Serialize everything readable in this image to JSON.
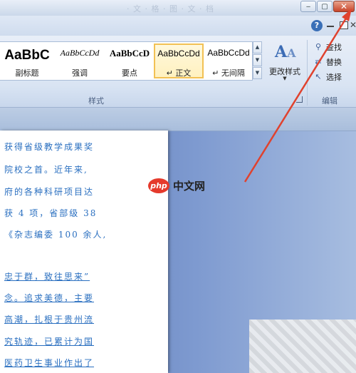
{
  "titlebar": {
    "faded_title": "· 文 · 格 · 图 · 文 · 档",
    "minimize": "‒",
    "maximize": "▢",
    "close": "✕"
  },
  "ribbon": {
    "help": "?",
    "close_doc": "✕"
  },
  "styles": {
    "group_label": "样式",
    "tiles": [
      {
        "preview": "AaBbC",
        "label": "副标题"
      },
      {
        "preview": "AaBbCcDd",
        "label": "强调"
      },
      {
        "preview": "AaBbCcD",
        "label": "要点"
      },
      {
        "preview": "AaBbCcDd",
        "label": "↵ 正文"
      },
      {
        "preview": "AaBbCcDd",
        "label": "↵ 无间隔"
      }
    ],
    "change_styles": "更改样式"
  },
  "editing": {
    "group_label": "编辑",
    "find": "查找",
    "replace": "替换",
    "select": "选择"
  },
  "document": {
    "lines": [
      "获得省级教学成果奖",
      "院校之首。近年来,",
      "府的各种科研项目达",
      "获 4 项，省部级 38",
      "《杂志编委 100 余人,",
      "忠于群，致往思来”",
      "念。追求美德，主要",
      "高潮，扎根于贵州流",
      "究轨迹，已累计为国",
      "医药卫生事业作出了"
    ]
  },
  "watermark": {
    "logo": "php",
    "text": "中文网"
  }
}
